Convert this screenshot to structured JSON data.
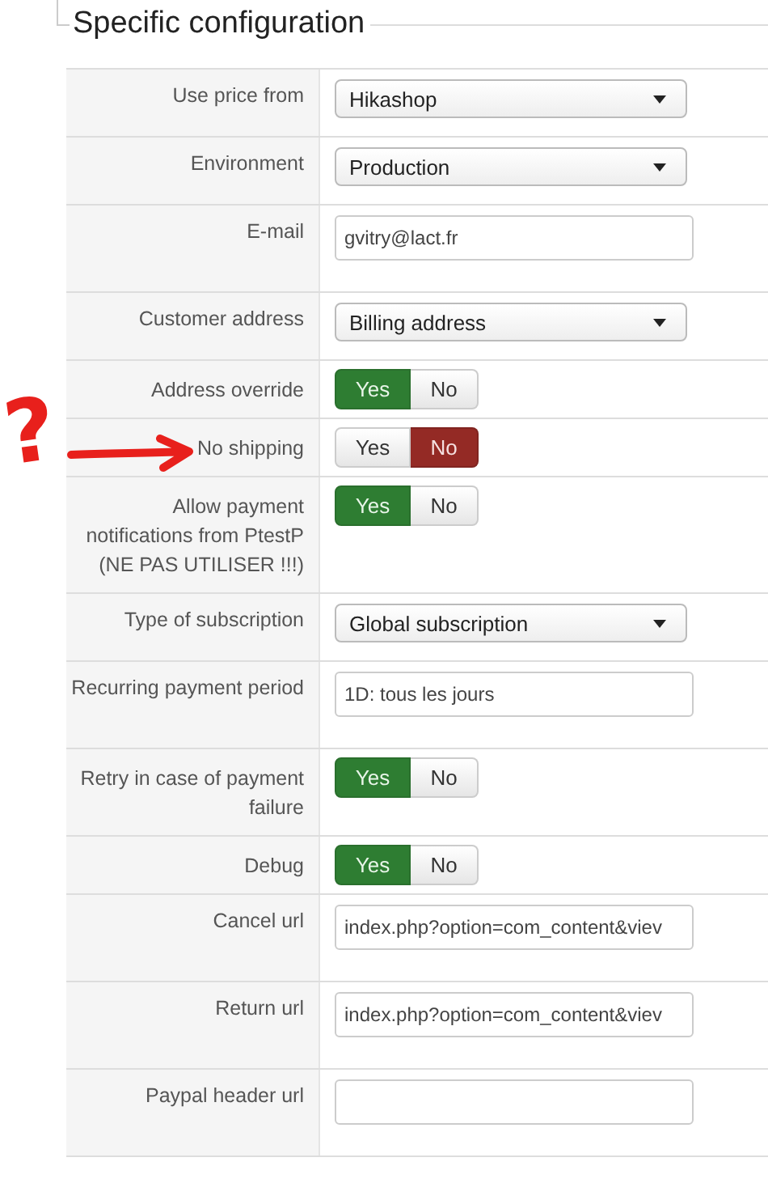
{
  "legend": "Specific configuration",
  "annotation": {
    "mark": "?"
  },
  "rows": [
    {
      "label": "Use price from",
      "kind": "select",
      "value": "Hikashop"
    },
    {
      "label": "Environment",
      "kind": "select",
      "value": "Production"
    },
    {
      "label": "E-mail",
      "kind": "text",
      "value": "gvitry@lact.fr"
    },
    {
      "label": "Customer address",
      "kind": "select",
      "value": "Billing address"
    },
    {
      "label": "Address override",
      "kind": "toggle",
      "options": [
        {
          "label": "Yes",
          "selected": true
        },
        {
          "label": "No",
          "selected": false
        }
      ]
    },
    {
      "label": "No shipping",
      "kind": "toggle",
      "annotated": true,
      "options": [
        {
          "label": "Yes",
          "selected": false
        },
        {
          "label": "No",
          "selected": true
        }
      ]
    },
    {
      "label": "Allow payment notifications from PtestP (NE PAS UTILISER !!!)",
      "kind": "toggle",
      "options": [
        {
          "label": "Yes",
          "selected": true
        },
        {
          "label": "No",
          "selected": false
        }
      ]
    },
    {
      "label": "Type of subscription",
      "kind": "select",
      "value": "Global subscription"
    },
    {
      "label": "Recurring payment period",
      "kind": "text",
      "value": "1D: tous les jours"
    },
    {
      "label": "Retry in case of payment failure",
      "kind": "toggle",
      "options": [
        {
          "label": "Yes",
          "selected": true
        },
        {
          "label": "No",
          "selected": false
        }
      ]
    },
    {
      "label": "Debug",
      "kind": "toggle",
      "options": [
        {
          "label": "Yes",
          "selected": true
        },
        {
          "label": "No",
          "selected": false
        }
      ]
    },
    {
      "label": "Cancel url",
      "kind": "text",
      "value": "index.php?option=com_content&viev"
    },
    {
      "label": "Return url",
      "kind": "text",
      "value": "index.php?option=com_content&viev"
    },
    {
      "label": "Paypal header url",
      "kind": "text"
    }
  ]
}
